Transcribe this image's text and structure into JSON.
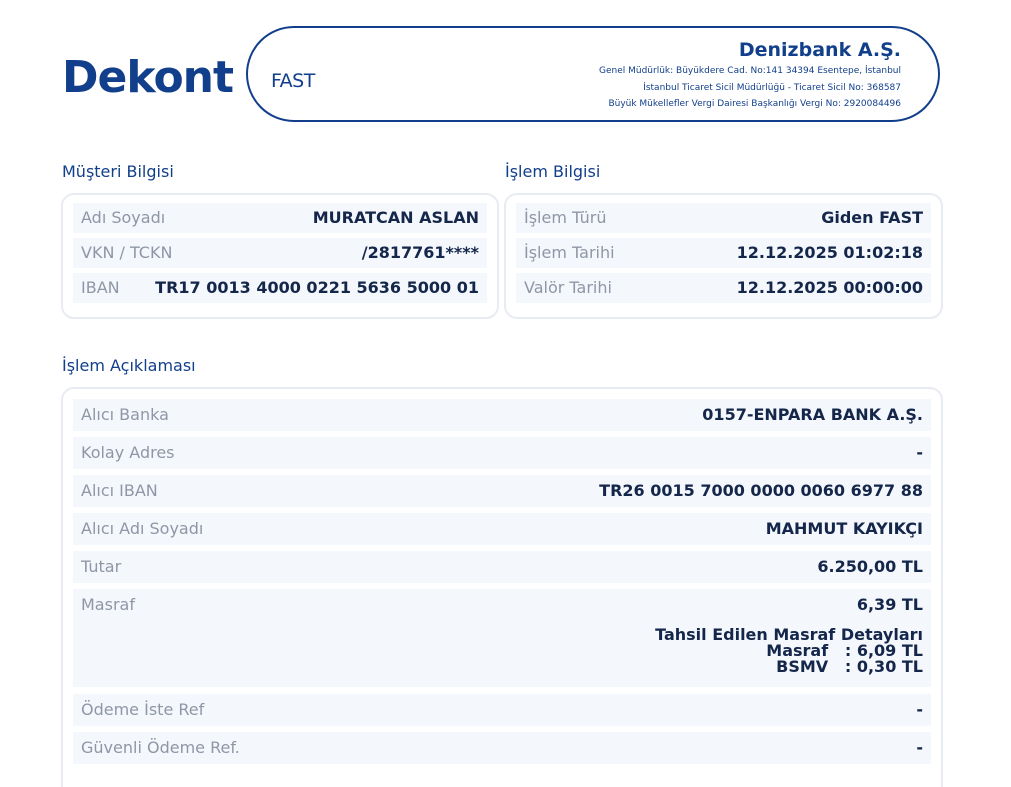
{
  "header": {
    "title": "Dekont",
    "type": "FAST",
    "bank_name": "Denizbank A.Ş.",
    "bank_address": "Genel Müdürlük: Büyükdere Cad. No:141 34394 Esentepe, İstanbul",
    "registry": "İstanbul Ticaret Sicil Müdürlüğü - Ticaret Sicil No: 368587",
    "tax_office": "Büyük Mükellefler Vergi Dairesi Başkanlığı Vergi No: 2920084496"
  },
  "customer": {
    "section_title": "Müşteri Bilgisi",
    "rows": [
      {
        "label": "Adı Soyadı",
        "value": "MURATCAN ASLAN"
      },
      {
        "label": "VKN / TCKN",
        "value": "/2817761****"
      },
      {
        "label": "IBAN",
        "value": "TR17 0013 4000 0221 5636 5000 01"
      }
    ]
  },
  "transaction": {
    "section_title": "İşlem Bilgisi",
    "rows": [
      {
        "label": "İşlem Türü",
        "value": "Giden FAST"
      },
      {
        "label": "İşlem Tarihi",
        "value": "12.12.2025 01:02:18"
      },
      {
        "label": "Valör Tarihi",
        "value": "12.12.2025 00:00:00"
      }
    ]
  },
  "description": {
    "section_title": "İşlem Açıklaması",
    "rows": [
      {
        "label": "Alıcı Banka",
        "value": "0157-ENPARA BANK A.Ş."
      },
      {
        "label": "Kolay Adres",
        "value": "-"
      },
      {
        "label": "Alıcı IBAN",
        "value": "TR26 0015 7000 0000 0060 6977 88"
      },
      {
        "label": "Alıcı Adı Soyadı",
        "value": "MAHMUT KAYIKÇI"
      },
      {
        "label": "Tutar",
        "value": "6.250,00 TL"
      },
      {
        "label": "Masraf",
        "value": "6,39 TL",
        "details_title": "Tahsil Edilen Masraf Detayları",
        "details": [
          "Masraf   : 6,09 TL",
          "BSMV   : 0,30 TL"
        ]
      },
      {
        "label": "Ödeme İste Ref",
        "value": "-"
      },
      {
        "label": "Güvenli Ödeme Ref.",
        "value": "-"
      }
    ]
  },
  "colors": {
    "brand_blue": "#123f8b",
    "row_background": "#f4f7fc",
    "label_gray": "#8f96a6",
    "value_text": "#14264a",
    "card_border": "#e8ebf2"
  }
}
